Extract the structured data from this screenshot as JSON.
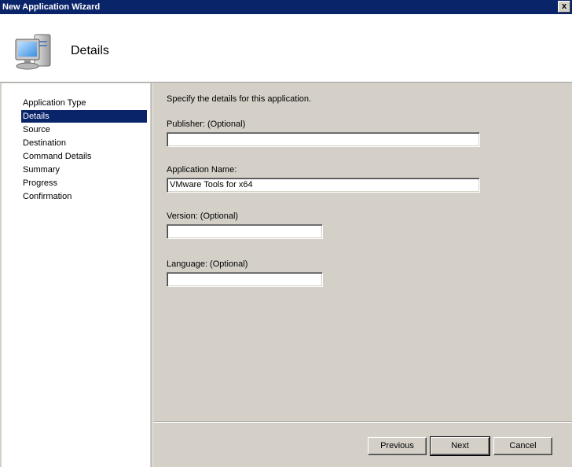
{
  "window": {
    "title": "New Application Wizard",
    "close_glyph": "x"
  },
  "header": {
    "title": "Details",
    "icon": "computer-icon"
  },
  "steps": [
    {
      "label": "Application Type",
      "active": false
    },
    {
      "label": "Details",
      "active": true
    },
    {
      "label": "Source",
      "active": false
    },
    {
      "label": "Destination",
      "active": false
    },
    {
      "label": "Command Details",
      "active": false
    },
    {
      "label": "Summary",
      "active": false
    },
    {
      "label": "Progress",
      "active": false
    },
    {
      "label": "Confirmation",
      "active": false
    }
  ],
  "form": {
    "intro": "Specify the details for this application.",
    "publisher": {
      "label": "Publisher: (Optional)",
      "value": ""
    },
    "app_name": {
      "label": "Application Name:",
      "value": "VMware Tools for x64"
    },
    "version": {
      "label": "Version: (Optional)",
      "value": ""
    },
    "language": {
      "label": "Language: (Optional)",
      "value": ""
    }
  },
  "buttons": {
    "previous": "Previous",
    "next": "Next",
    "cancel": "Cancel"
  },
  "colors": {
    "titlebar": "#0a246a",
    "selection": "#0a246a",
    "dialog_bg": "#d4d0c8"
  }
}
